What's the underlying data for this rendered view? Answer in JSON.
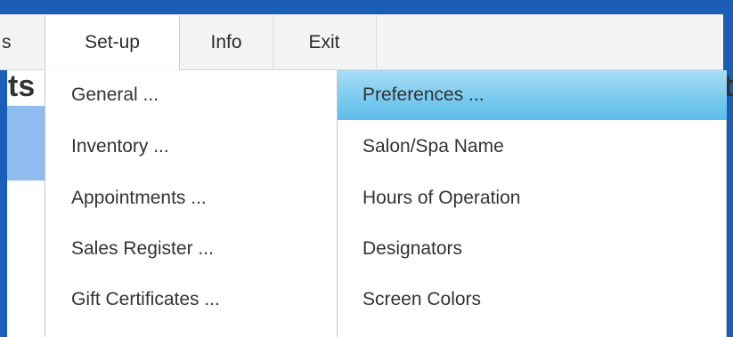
{
  "menubar": {
    "items": [
      {
        "label": "s"
      },
      {
        "label": "Set-up"
      },
      {
        "label": "Info"
      },
      {
        "label": "Exit"
      }
    ]
  },
  "background": {
    "left_fragment": "ts",
    "right_fragment": "t"
  },
  "setup_menu": {
    "items": [
      {
        "label": "General ..."
      },
      {
        "label": "Inventory ..."
      },
      {
        "label": "Appointments ..."
      },
      {
        "label": "Sales Register ..."
      },
      {
        "label": "Gift Certificates ..."
      }
    ]
  },
  "general_submenu": {
    "items": [
      {
        "label": "Preferences ..."
      },
      {
        "label": "Salon/Spa Name"
      },
      {
        "label": "Hours of Operation"
      },
      {
        "label": "Designators"
      },
      {
        "label": "Screen Colors"
      }
    ]
  },
  "colors": {
    "frame": "#1b5eb8",
    "menubar": "#f4f4f4",
    "band": "#8fbcef",
    "highlight": "#7ccbef"
  }
}
